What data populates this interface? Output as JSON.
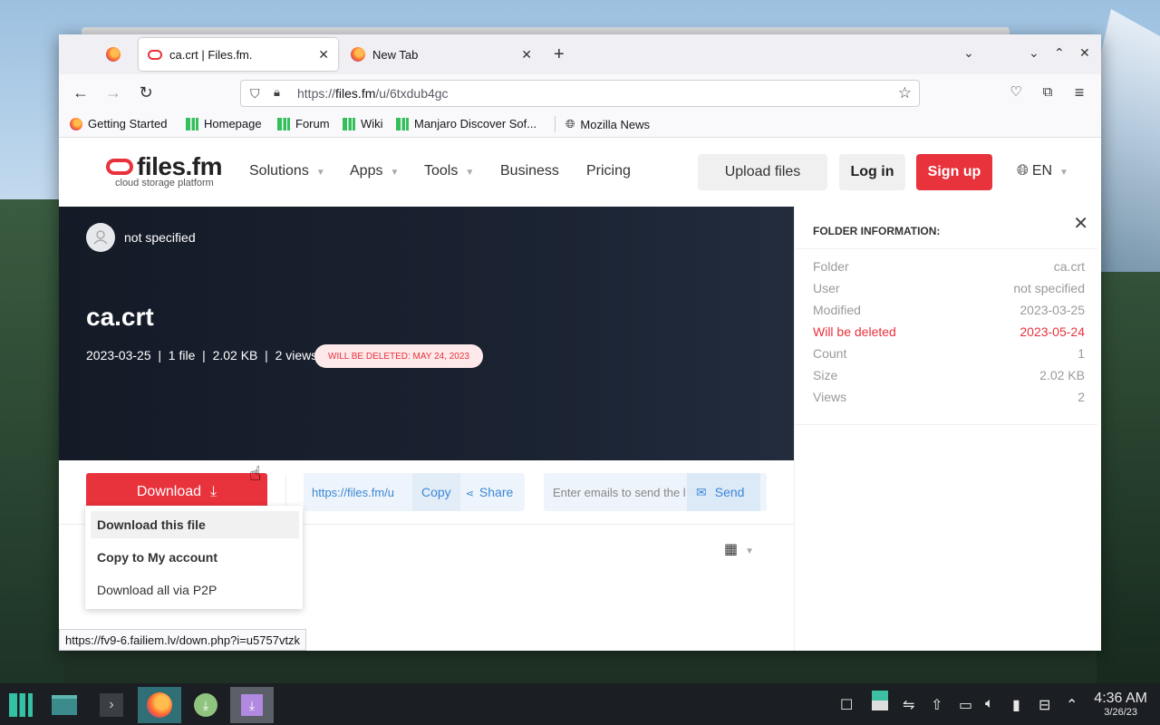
{
  "browser": {
    "tabs": [
      {
        "label": "ca.crt | Files.fm.",
        "active": true
      },
      {
        "label": "New Tab",
        "active": false
      }
    ],
    "new_tab_glyph": "+",
    "url_prefix": "https://",
    "url_host": "files.fm",
    "url_path": "/u/6txdub4gc",
    "bookmarks": [
      "Getting Started",
      "Homepage",
      "Forum",
      "Wiki",
      "Manjaro Discover Sof...",
      "Mozilla News"
    ],
    "status_url": "https://fv9-6.failiem.lv/down.php?i=u5757vtzk"
  },
  "site": {
    "logo_main": "files.fm",
    "logo_tagline": "cloud storage platform",
    "nav": [
      "Solutions",
      "Apps",
      "Tools",
      "Business",
      "Pricing"
    ],
    "upload_label": "Upload files",
    "login_label": "Log in",
    "signup_label": "Sign up",
    "lang_label": "EN"
  },
  "hero": {
    "owner": "not specified",
    "filename": "ca.crt",
    "meta": "2023-03-25  |  1 file  |  2.02 KB  |  2 views",
    "deletion_badge": "WILL BE DELETED: MAY 24, 2023"
  },
  "actions": {
    "download_label": "Download",
    "share_url": "https://files.fm/u",
    "copy_label": "Copy",
    "share_label": "Share",
    "email_placeholder": "Enter emails to send the l",
    "send_label": "Send",
    "dropdown": [
      "Download this file",
      "Copy to My account",
      "Download all via P2P"
    ]
  },
  "folder_info": {
    "title": "FOLDER INFORMATION:",
    "rows": [
      {
        "label": "Folder",
        "value": "ca.crt"
      },
      {
        "label": "User",
        "value": "not specified"
      },
      {
        "label": "Modified",
        "value": "2023-03-25"
      },
      {
        "label": "Will be deleted",
        "value": "2023-05-24"
      },
      {
        "label": "Count",
        "value": "1"
      },
      {
        "label": "Size",
        "value": "2.02 KB"
      },
      {
        "label": "Views",
        "value": "2"
      }
    ]
  },
  "taskbar": {
    "time": "4:36 AM",
    "date": "3/26/23"
  },
  "colors": {
    "accent": "#e8323c",
    "link": "#3b87d6",
    "hero_bg": "#161d2a"
  }
}
